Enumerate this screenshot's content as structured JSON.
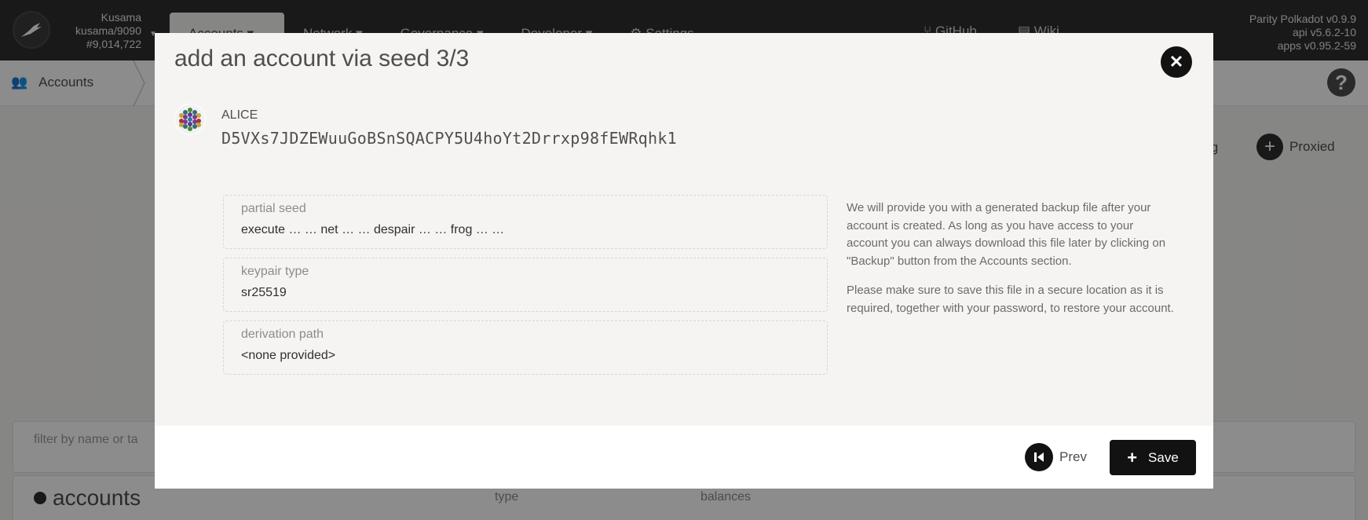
{
  "chain": {
    "name": "Kusama",
    "node": "kusama/9090",
    "block": "#9,014,722"
  },
  "menu": {
    "accounts": "Accounts",
    "network": "Network",
    "governance": "Governance",
    "developer": "Developer",
    "settings": "Settings",
    "github": "GitHub",
    "wiki": "Wiki"
  },
  "versions": {
    "node": "Parity Polkadot v0.9.9",
    "api": "api v5.6.2-10",
    "apps": "apps v0.95.2-59"
  },
  "subnav": {
    "accounts_tab": "Accounts",
    "help_icon": "?"
  },
  "page": {
    "multisig_label": "ig",
    "proxied_label": "Proxied",
    "filter_placeholder": "filter by name or ta",
    "accounts_title": "accounts",
    "col_type": "type",
    "col_balances": "balances"
  },
  "modal": {
    "title": "add an account via seed 3/3",
    "account_name": "ALICE",
    "account_address": "D5VXs7JDZEWuuGoBSnSQACPY5U4hoYt2Drrxp98fEWRqhk1",
    "fields": [
      {
        "label": "partial seed",
        "value": "execute … … net … … despair … … frog … …"
      },
      {
        "label": "keypair type",
        "value": "sr25519"
      },
      {
        "label": "derivation path",
        "value": "<none provided>"
      }
    ],
    "help_paragraphs": [
      "We will provide you with a generated backup file after your account is created. As long as you have access to your account you can always download this file later by clicking on \"Backup\" button from the Accounts section.",
      "Please make sure to save this file in a secure location as it is required, together with your password, to restore your account."
    ],
    "prev_label": "Prev",
    "save_label": "Save"
  },
  "colors": {
    "topbar": "#2f2f2f",
    "button_dark": "#121212",
    "background": "#f5f4f3"
  }
}
